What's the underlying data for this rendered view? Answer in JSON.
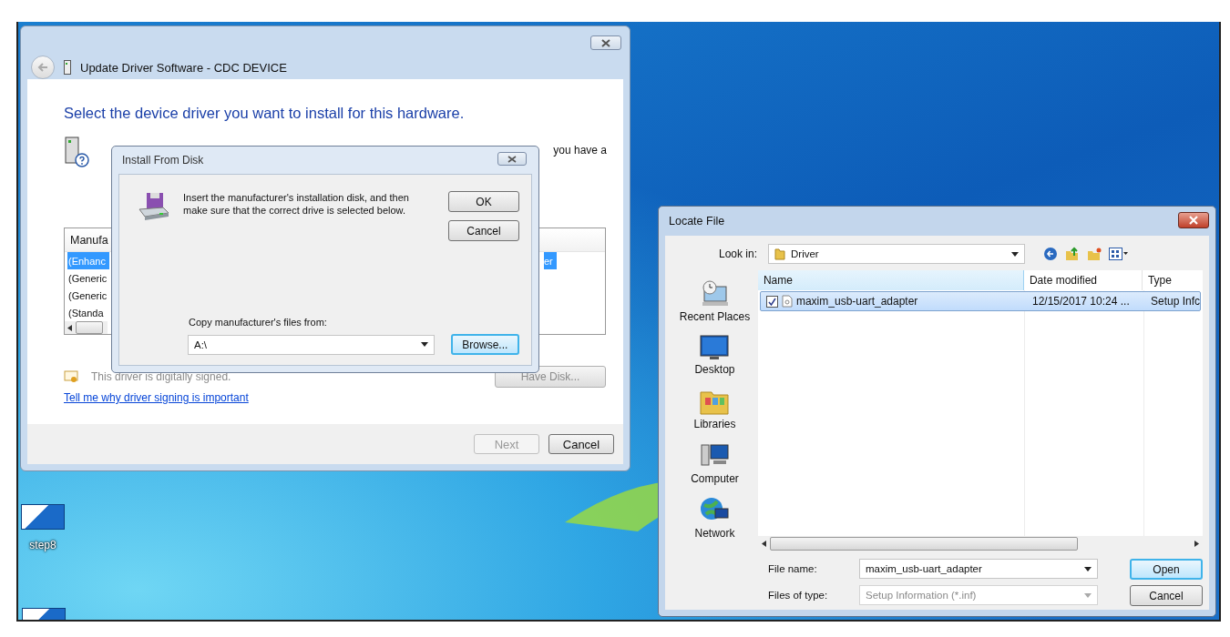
{
  "desktop_icons": [
    {
      "label": "step8"
    }
  ],
  "update_driver_window": {
    "title": "Update Driver Software - CDC DEVICE",
    "heading": "Select the device driver you want to install for this hardware.",
    "partial_text": "you have a",
    "list": {
      "column_1": "Manufa",
      "rows": [
        {
          "text": "(Enhanc",
          "tail": "er",
          "selected": true
        },
        {
          "text": "(Generic",
          "selected": false
        },
        {
          "text": "(Generic",
          "selected": false
        },
        {
          "text": "(Standa",
          "selected": false
        }
      ]
    },
    "signed_text": "This driver is digitally signed.",
    "have_disk_button": "Have Disk...",
    "help_link": "Tell me why driver signing is important",
    "buttons": [
      {
        "label": "Next",
        "disabled": true
      },
      {
        "label": "Cancel",
        "disabled": false
      }
    ]
  },
  "install_dialog": {
    "title": "Install From Disk",
    "message": "Insert the manufacturer's installation disk, and then make sure that the correct drive is selected below.",
    "buttons": [
      {
        "label": "OK"
      },
      {
        "label": "Cancel"
      }
    ],
    "copy_label": "Copy manufacturer's files from:",
    "path": "A:\\",
    "browse_button": {
      "label": "Browse...",
      "focused": true
    }
  },
  "locate_file_window": {
    "title": "Locate File",
    "look_in_label": "Look in:",
    "look_in_value": "Driver",
    "places": [
      {
        "label": "Recent Places",
        "kind": "recent"
      },
      {
        "label": "Desktop",
        "kind": "desktop"
      },
      {
        "label": "Libraries",
        "kind": "libraries"
      },
      {
        "label": "Computer",
        "kind": "computer"
      },
      {
        "label": "Network",
        "kind": "network"
      }
    ],
    "columns": [
      "Name",
      "Date modified",
      "Type"
    ],
    "files": [
      {
        "name": "maxim_usb-uart_adapter",
        "date": "12/15/2017 10:24 ...",
        "type": "Setup Infc",
        "selected": true,
        "checked": true
      }
    ],
    "file_name_label": "File name:",
    "file_name": "maxim_usb-uart_adapter",
    "file_type_label": "Files of type:",
    "file_type": "Setup Information (*.inf)",
    "file_type_disabled": true,
    "buttons": [
      {
        "label": "Open",
        "focused": true
      },
      {
        "label": "Cancel",
        "focused": false
      }
    ]
  }
}
